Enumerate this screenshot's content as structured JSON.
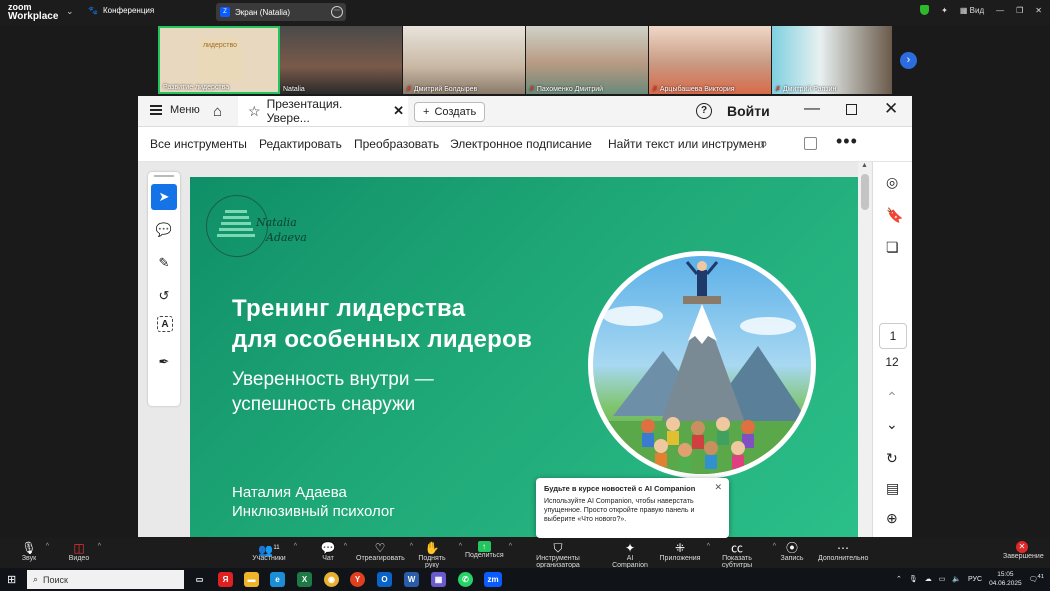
{
  "zoom": {
    "logo_line1": "zoom",
    "logo_line2": "Workplace",
    "conference_label": "Конференция",
    "screen_tab_label": "Экран (Natalia)",
    "view_label": "Вид",
    "participants": [
      {
        "name": "Развитие лидерства",
        "badge": "лидерство"
      },
      {
        "name": "Natalia"
      },
      {
        "name": "Дмитрий Болдырев",
        "muted": true
      },
      {
        "name": "Пахоменко Дмитрий",
        "muted": true
      },
      {
        "name": "Арцыбашева Виктория",
        "muted": true
      },
      {
        "name": "Дмитрий Рапзин",
        "muted": true
      }
    ],
    "bottom": {
      "audio": "Звук",
      "video": "Видео",
      "participants": "Участники",
      "participants_count": "11",
      "chat": "Чат",
      "react": "Отреагировать",
      "raise_hand": "Поднять руку",
      "share": "Поделиться",
      "host_tools": "Инструменты организатора",
      "ai": "AI Companion",
      "apps": "Приложения",
      "captions": "Показать субтитры",
      "record": "Запись",
      "more": "Дополнительно",
      "end": "Завершение"
    },
    "toast": {
      "title": "Будьте в курсе новостей с AI Companion",
      "body": "Используйте AI Companion, чтобы наверстать упущенное. Просто откройте правую панель и выберите «Что нового?»."
    }
  },
  "acrobat": {
    "menu_label": "Меню",
    "doc_tab_title": "Презентация. Увере...",
    "create_label": "Создать",
    "login_label": "Войти",
    "toolbar": {
      "all_tools": "Все инструменты",
      "edit": "Редактировать",
      "convert": "Преобразовать",
      "esign": "Электронное подписание",
      "find": "Найти текст или инструмент"
    },
    "page_current": "1",
    "page_total": "12"
  },
  "slide": {
    "logo_line1": "Natalia",
    "logo_line2": "Adaeva",
    "title_line1": "Тренинг лидерства",
    "title_line2": "для особенных лидеров",
    "subtitle_line1": "Уверенность внутри —",
    "subtitle_line2": "успешность снаружи",
    "author_name": "Наталия Адаева",
    "author_role": "Инклюзивный психолог"
  },
  "taskbar": {
    "search_placeholder": "Поиск",
    "lang": "РУС",
    "time": "15:05",
    "date": "04.06.2025",
    "notifications": "41"
  },
  "colors": {
    "slide_green": "#1fa877",
    "acrobat_blue": "#1473e6",
    "zoom_blue": "#2d6cdf",
    "active_speaker": "#22c55e",
    "end_red": "#e02828"
  }
}
